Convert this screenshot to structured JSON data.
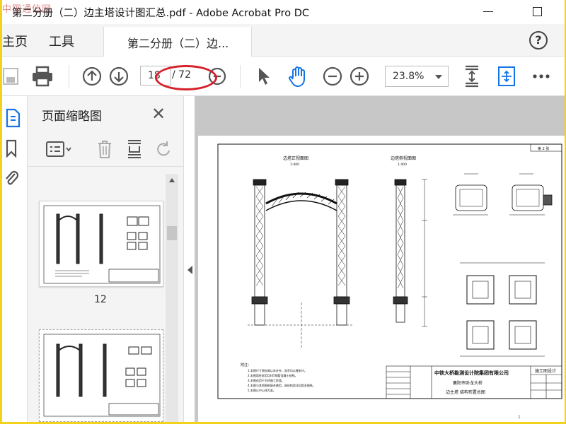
{
  "window": {
    "title": "第二分册（二）边主塔设计图汇总.pdf - Adobe Acrobat Pro DC",
    "watermark": "中国通信网"
  },
  "tabs": {
    "home": "主页",
    "tools": "工具",
    "document": "第二分册（二）边..."
  },
  "toolbar": {
    "page_current": "18",
    "page_total": "/ 72",
    "zoom": "23.8%"
  },
  "thumbnail_panel": {
    "title": "页面缩略图",
    "items": [
      {
        "label": "12"
      }
    ]
  },
  "drawing": {
    "front_elevation_title": "边塔正视面图",
    "side_elevation_title": "边塔侧视面图",
    "scale": "1:400",
    "notes_heading": "附注：",
    "notes": [
      "1.本图尺寸除标高以米计外，其余均以厘米计。",
      "2.本图塔柱采用Q345钢管混凝土结构。",
      "3.本图适用于主桥施工阶段。",
      "4.本图与其他图纸配合使用，具体构造详见相关图纸。",
      "5.本图以中心线为准。"
    ],
    "company": "中铁大桥勘测设计院集团有限公司",
    "project": "襄阳市卧龙大桥",
    "drawing_name": "边主塔 结构布置总图",
    "stage": "施工图设计",
    "sheet": "第 2 张",
    "page_number": "1"
  },
  "colors": {
    "accent_blue": "#1473e6",
    "annotation_red": "#d6202a"
  }
}
